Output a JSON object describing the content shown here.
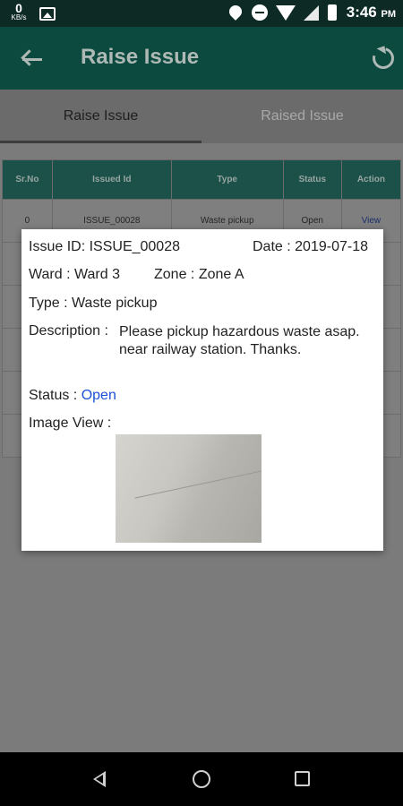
{
  "status_bar": {
    "net_speed_value": "0",
    "net_speed_unit": "KB/s",
    "time": "3:46",
    "ampm": "PM",
    "icons": [
      "gallery-icon",
      "location-icon",
      "dnd-icon",
      "wifi-icon",
      "signal-icon",
      "battery-icon"
    ]
  },
  "app_bar": {
    "title": "Raise Issue",
    "back_icon": "back-arrow-icon",
    "refresh_icon": "refresh-icon"
  },
  "tabs": [
    {
      "label": "Raise Issue",
      "active": true
    },
    {
      "label": "Raised Issue",
      "active": false
    }
  ],
  "table": {
    "headers": [
      "Sr.No",
      "Issued Id",
      "Type",
      "Status",
      "Action"
    ],
    "rows": [
      {
        "srno": "0",
        "issued_id": "ISSUE_00028",
        "type": "Waste pickup",
        "status": "Open",
        "action": "View"
      }
    ]
  },
  "dialog": {
    "issue_id_label": "Issue ID:",
    "issue_id": "ISSUE_00028",
    "date_label": "Date :",
    "date": "2019-07-18",
    "ward_label": "Ward :",
    "ward": "Ward 3",
    "zone_label": "Zone :",
    "zone": "Zone A",
    "type_label": "Type :",
    "type": "Waste pickup",
    "description_label": "Description :",
    "description": "Please pickup hazardous waste asap. near railway station. Thanks.",
    "status_label": "Status :",
    "status": "Open",
    "image_view_label": "Image View :",
    "status_color": "#1a4fd6"
  },
  "colors": {
    "app_bar": "#0c4a3f",
    "status_bar": "#0d2a25",
    "table_header": "#1c5149"
  }
}
